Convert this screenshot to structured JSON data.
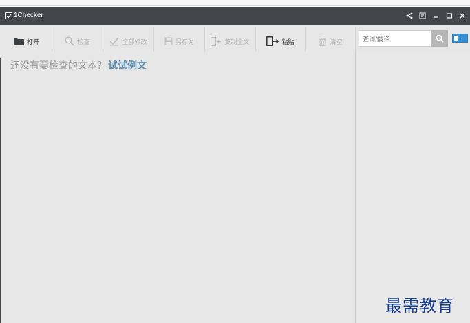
{
  "app": {
    "title": "1Checker"
  },
  "toolbar": {
    "open": "打开",
    "check": "检查",
    "fix_all": "全部修改",
    "save_as": "另存为",
    "copy_all": "复制全文",
    "paste": "粘贴",
    "clear": "清空"
  },
  "search": {
    "placeholder": "查词/翻译"
  },
  "editor": {
    "prompt": "还没有要检查的文本？",
    "example_link": "试试例文"
  },
  "watermark": {
    "text": "最需教育"
  },
  "colors": {
    "titlebar": "#43474c",
    "toolbar": "#e7e7e7",
    "accent_link": "#5a8cae",
    "toggle": "#3a8fd0",
    "watermark": "#173f91"
  },
  "icons": {
    "titlebar": [
      "share-icon",
      "feedback-icon",
      "minimize-icon",
      "maximize-icon",
      "close-icon"
    ],
    "toolbar": [
      "folder-icon",
      "magnifier-icon",
      "check-icon",
      "save-icon",
      "copy-icon",
      "paste-icon",
      "trash-icon"
    ]
  }
}
